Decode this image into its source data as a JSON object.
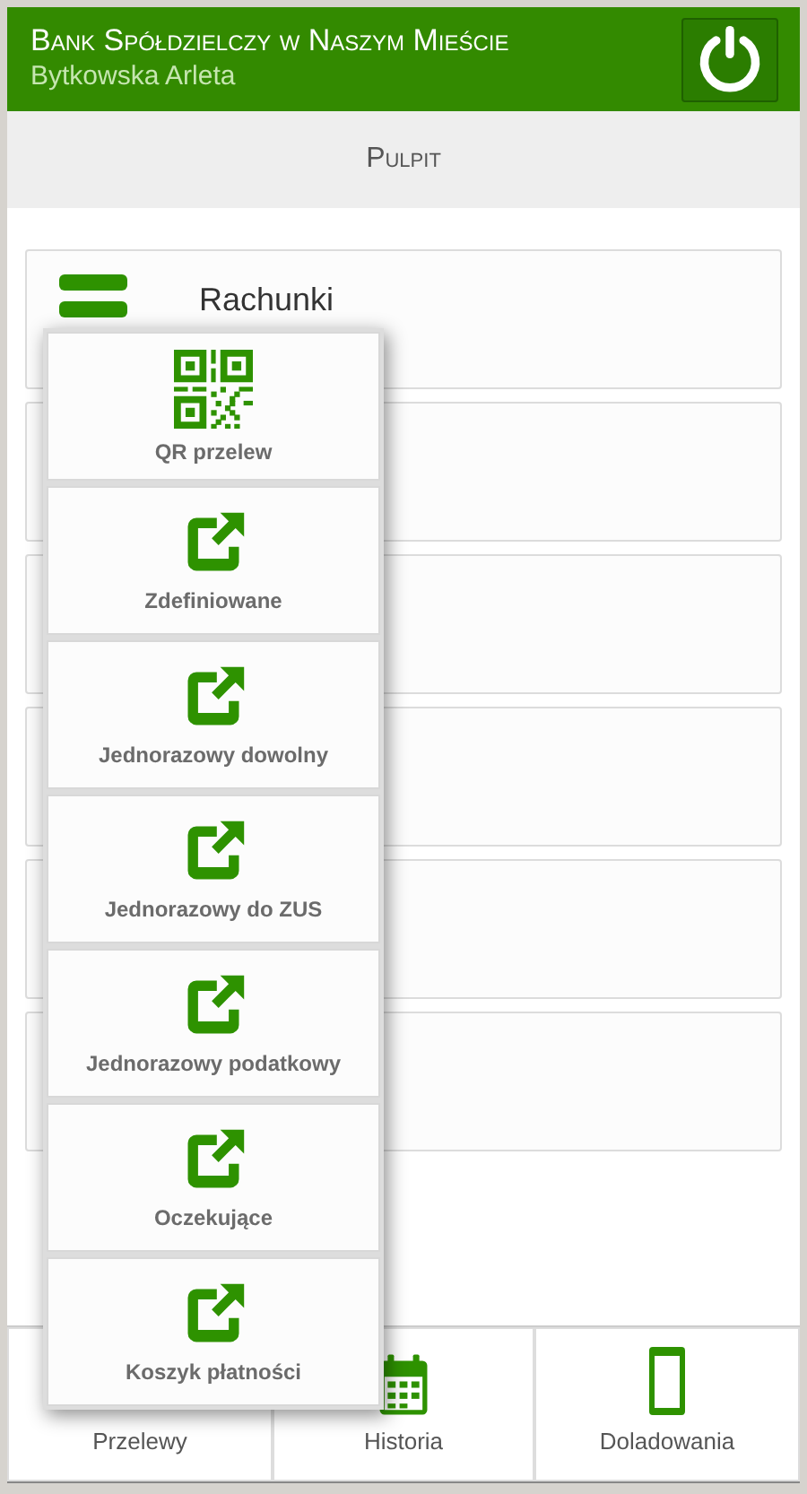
{
  "header": {
    "bank_name": "Bank Spółdzielczy w Naszym Mieście",
    "user_name": "Bytkowska Arleta"
  },
  "page_title": "Pulpit",
  "cards": [
    {
      "kind": "accounts",
      "label": "Rachunki"
    },
    {
      "kind": "blank"
    },
    {
      "kind": "blank"
    },
    {
      "kind": "blank"
    },
    {
      "kind": "blank"
    },
    {
      "kind": "blank"
    }
  ],
  "popup_menu": [
    {
      "kind": "qr",
      "label": "QR przelew"
    },
    {
      "kind": "link",
      "label": "Zdefiniowane"
    },
    {
      "kind": "link",
      "label": "Jednorazowy dowolny"
    },
    {
      "kind": "link",
      "label": "Jednorazowy do ZUS"
    },
    {
      "kind": "link",
      "label": "Jednorazowy podatkowy"
    },
    {
      "kind": "link",
      "label": "Oczekujące"
    },
    {
      "kind": "link",
      "label": "Koszyk płatności"
    }
  ],
  "bottom_nav": [
    {
      "kind": "transfers",
      "label": "Przelewy"
    },
    {
      "kind": "calendar",
      "label": "Historia"
    },
    {
      "kind": "phone",
      "label": "Doladowania"
    }
  ]
}
